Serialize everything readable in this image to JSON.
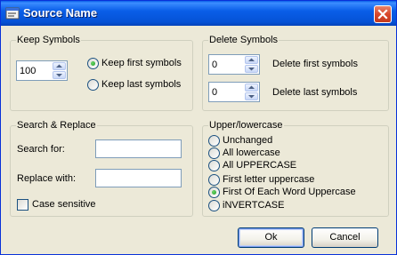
{
  "window": {
    "title": "Source Name",
    "close_symbol": "×"
  },
  "keep_symbols": {
    "group_label": "Keep Symbols",
    "count_value": "100",
    "options": [
      {
        "label": "Keep first symbols",
        "selected": true
      },
      {
        "label": "Keep last symbols",
        "selected": false
      }
    ]
  },
  "delete_symbols": {
    "group_label": "Delete Symbols",
    "first_value": "0",
    "first_label": "Delete first symbols",
    "last_value": "0",
    "last_label": "Delete last symbols"
  },
  "search_replace": {
    "group_label": "Search & Replace",
    "search_label": "Search for:",
    "search_value": "",
    "replace_label": "Replace with:",
    "replace_value": "",
    "case_sensitive_label": "Case sensitive",
    "case_sensitive_checked": false
  },
  "case": {
    "group_label": "Upper/lowercase",
    "options": [
      {
        "label": "Unchanged",
        "selected": false
      },
      {
        "label": "All lowercase",
        "selected": false
      },
      {
        "label": "All UPPERCASE",
        "selected": false
      },
      {
        "label": "First letter uppercase",
        "selected": false
      },
      {
        "label": "First Of Each Word Uppercase",
        "selected": true
      },
      {
        "label": "iNVERTCASE",
        "selected": false
      }
    ]
  },
  "buttons": {
    "ok": "Ok",
    "cancel": "Cancel"
  },
  "colors": {
    "titlebar": "#0a5ee8",
    "dialog_bg": "#ece9d8",
    "radio_selected": "#21a121"
  }
}
